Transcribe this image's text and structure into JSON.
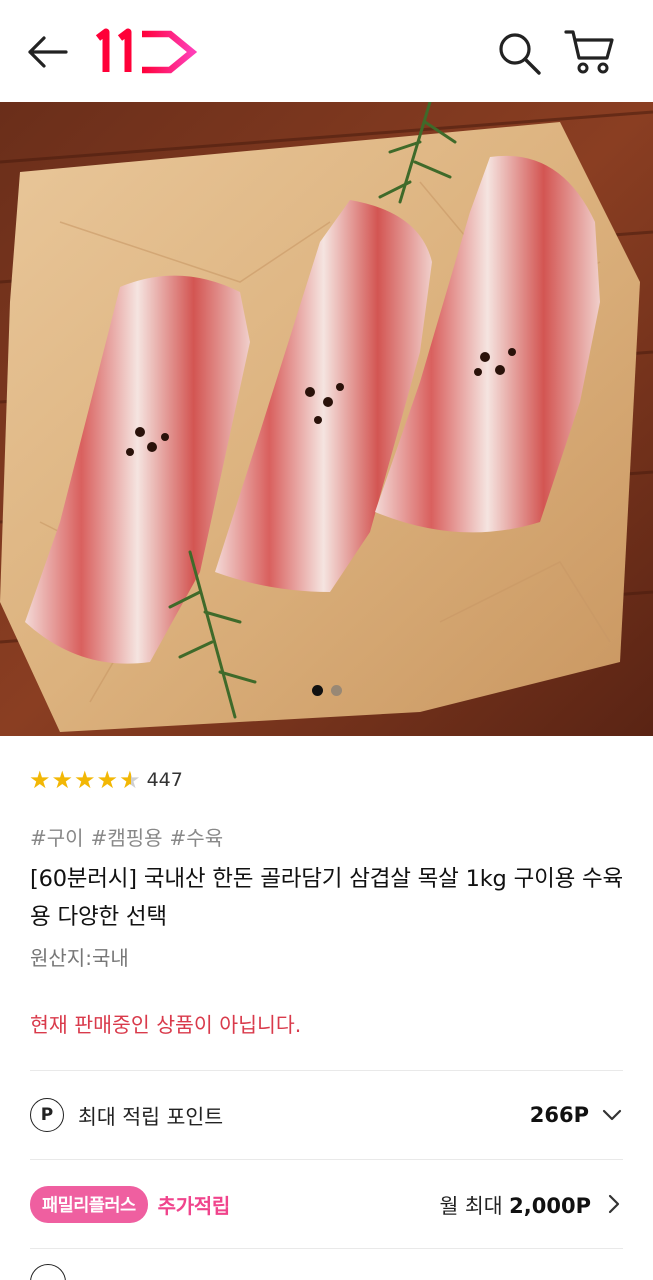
{
  "header": {
    "logo_text": "11",
    "icons": {
      "back": "arrow-left-icon",
      "search": "search-icon",
      "cart": "cart-icon"
    }
  },
  "gallery": {
    "image_alt": "",
    "current_slide": 1,
    "total_slides": 2
  },
  "product": {
    "rating_value": 4.5,
    "review_count": "447",
    "tags": [
      "#구이",
      "#캠핑용",
      "#수육"
    ],
    "title": "[60분러시] 국내산 한돈 골라담기 삼겹살 목살 1kg 구이용 수육용 다양한 선택",
    "origin": "원산지:국내",
    "status_notice": "현재 판매중인 상품이 아닙니다."
  },
  "points": {
    "icon_letter": "P",
    "label": "최대 적립 포인트",
    "value": "266P"
  },
  "family_plus": {
    "badge": "패밀리플러스",
    "extra_label": "추가적립",
    "monthly_prefix": "월 최대",
    "monthly_value": "2,000P"
  },
  "colors": {
    "brand_pink": "#ff0038",
    "notice_red": "#d93a4b",
    "family_pink": "#ef5fa0",
    "star": "#f2b705"
  }
}
